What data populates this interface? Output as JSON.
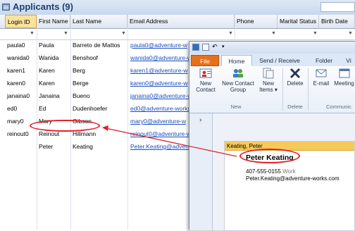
{
  "app": {
    "title": "Applicants (9)"
  },
  "grid": {
    "columns": [
      "Login ID",
      "First Name",
      "Last Name",
      "Email Address",
      "Phone",
      "Marital Status",
      "Birth Date"
    ],
    "rows": [
      {
        "login": "paula0",
        "first": "Paula",
        "last": "Barreto de Mattos",
        "email": "paula0@adventure-w"
      },
      {
        "login": "wanida0",
        "first": "Wanida",
        "last": "Benshoof",
        "email": "wanida0@adventure-w"
      },
      {
        "login": "karen1",
        "first": "Karen",
        "last": "Berg",
        "email": "karen1@adventure-w"
      },
      {
        "login": "karen0",
        "first": "Karen",
        "last": "Berge",
        "email": "karen0@adventure-w"
      },
      {
        "login": "janaina0",
        "first": "Janaina",
        "last": "Bueno",
        "email": "janaina0@adventure-w"
      },
      {
        "login": "ed0",
        "first": "Ed",
        "last": "Dudenhoefer",
        "email": "ed0@adventure-works"
      },
      {
        "login": "mary0",
        "first": "Mary",
        "last": "Gibson",
        "email": "mary0@adventure-w"
      },
      {
        "login": "reinout0",
        "first": "Reinout",
        "last": "Hillmann",
        "email": "reinout0@adventure-w"
      },
      {
        "login": "",
        "first": "Peter",
        "last": "Keating",
        "email": "Peter.Keating@advent"
      }
    ]
  },
  "outlook": {
    "tabs": [
      "File",
      "Home",
      "Send / Receive",
      "Folder",
      "Vi"
    ],
    "buttons": {
      "new_contact": "New\nContact",
      "new_contact_group": "New Contact\nGroup",
      "new_items": "New\nItems ▾",
      "delete": "Delete",
      "email": "E-mail",
      "meeting": "Meeting"
    },
    "groups": [
      "New",
      "Delete",
      "Communic"
    ],
    "contact": {
      "header": "Keating, Peter",
      "name": "Peter Keating",
      "phone": "407-555-0155",
      "phone_type": "Work",
      "email": "Peter.Keating@adventure-works.com"
    }
  },
  "colors": {
    "accent": "#1f3f73",
    "file_tab": "#e8701b",
    "highlight": "#e0202c",
    "card_header": "#f5c95a"
  }
}
